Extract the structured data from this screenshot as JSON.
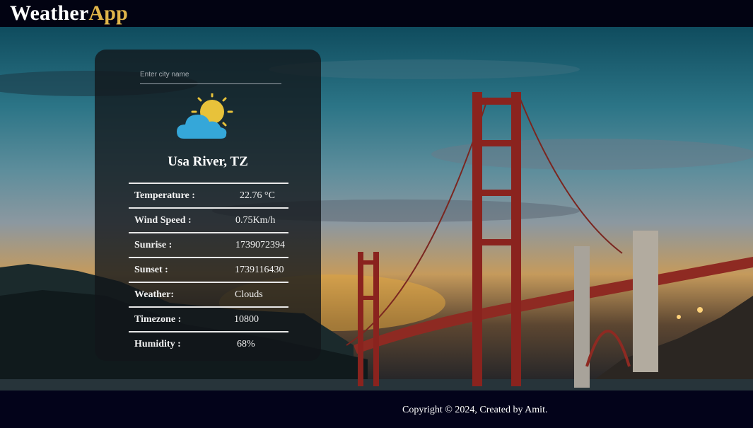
{
  "app": {
    "logo_part1": "Weather",
    "logo_part2": "App"
  },
  "search": {
    "placeholder": "Enter city name",
    "value": ""
  },
  "weather": {
    "icon": "sun-behind-cloud-icon",
    "city": "Usa River, TZ",
    "rows": [
      {
        "label": "Temperature :",
        "value": "22.76 °C"
      },
      {
        "label": "Wind Speed :",
        "value": "0.75Km/h"
      },
      {
        "label": "Sunrise :",
        "value": "1739072394"
      },
      {
        "label": "Sunset :",
        "value": "1739116430"
      },
      {
        "label": "Weather:",
        "value": "Clouds"
      },
      {
        "label": "Timezone :",
        "value": "10800"
      },
      {
        "label": "Humidity :",
        "value": "68%"
      }
    ]
  },
  "footer": {
    "copyright": "Copyright © 2024, Created by Amit."
  },
  "colors": {
    "accent": "#e0b54a",
    "header_bg": "#020312",
    "cloud": "#35a7d9",
    "sun": "#e8c23a"
  }
}
